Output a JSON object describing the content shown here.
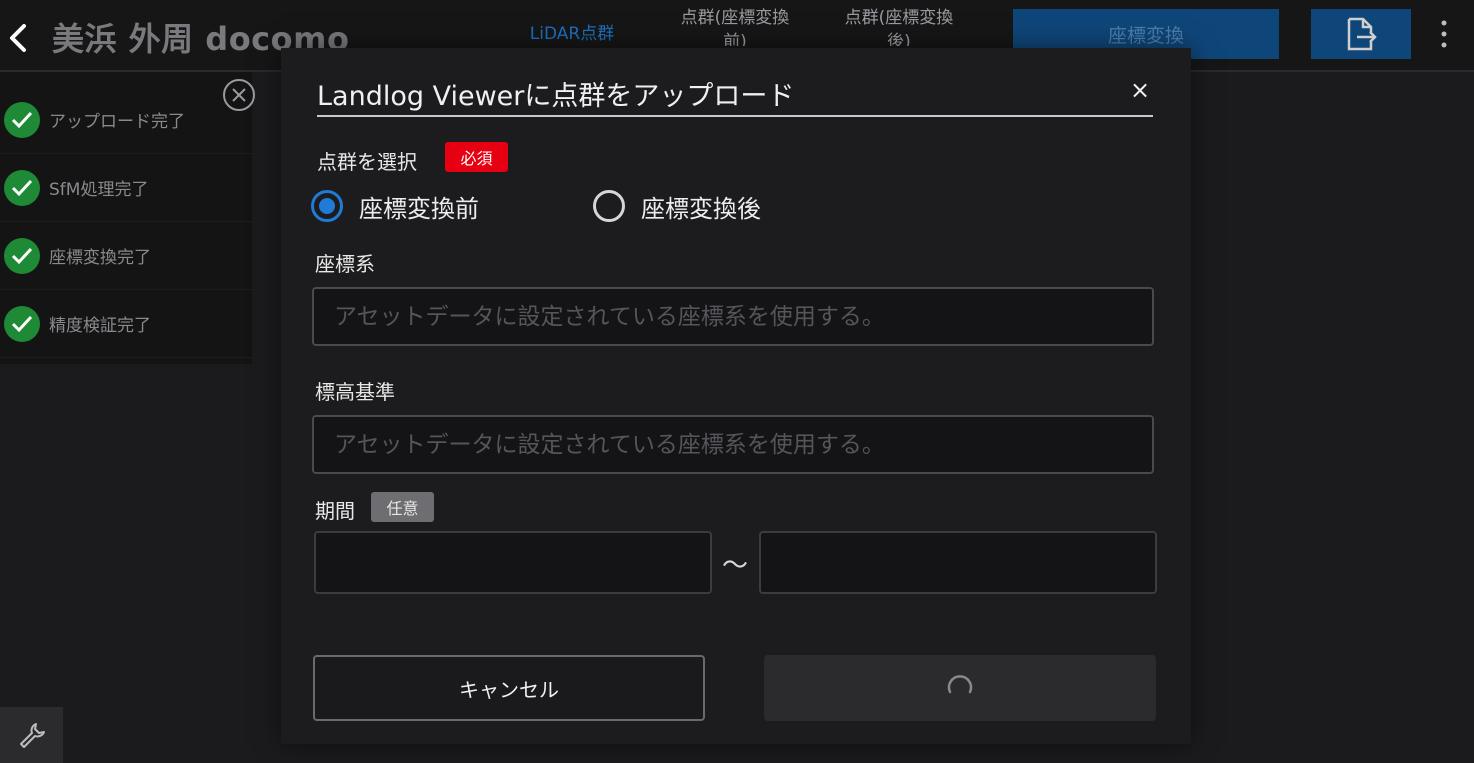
{
  "header": {
    "title": "美浜 外周 docomo",
    "tabs": [
      {
        "label": "LiDAR点群"
      },
      {
        "label": "点群(座標変換前)"
      },
      {
        "label": "点群(座標変換後)"
      }
    ],
    "convert_label": "座標変換",
    "back_icon": "chevron-left-icon",
    "export_icon": "file-export-icon",
    "more_icon": "kebab-menu-icon",
    "accent_color": "#0f4679"
  },
  "status": {
    "items": [
      {
        "label": "アップロード完了",
        "icon": "check-circle-icon"
      },
      {
        "label": "SfM処理完了",
        "icon": "check-circle-icon"
      },
      {
        "label": "座標変換完了",
        "icon": "check-circle-icon"
      },
      {
        "label": "精度検証完了",
        "icon": "check-circle-icon"
      }
    ],
    "check_color": "#1f9a3a"
  },
  "dialog": {
    "title": "Landlog Viewerに点群をアップロード",
    "close_glyph": "×",
    "pointcloud_label": "点群を選択",
    "required_badge": "必須",
    "radio_before": "座標変換前",
    "radio_after": "座標変換後",
    "selected": "before",
    "crs_label": "座標系",
    "crs_placeholder": "アセットデータに設定されている座標系を使用する。",
    "height_label": "標高基準",
    "height_placeholder": "アセットデータに設定されている座標系を使用する。",
    "period_label": "期間",
    "optional_badge": "任意",
    "period_from": "",
    "period_to": "",
    "tilde": "～",
    "cancel_label": "キャンセル",
    "submit_state": "loading-spinner-icon",
    "radio_color": "#1f7bd6",
    "required_color": "#e60012"
  },
  "tools": {
    "wrench_icon": "wrench-icon"
  }
}
